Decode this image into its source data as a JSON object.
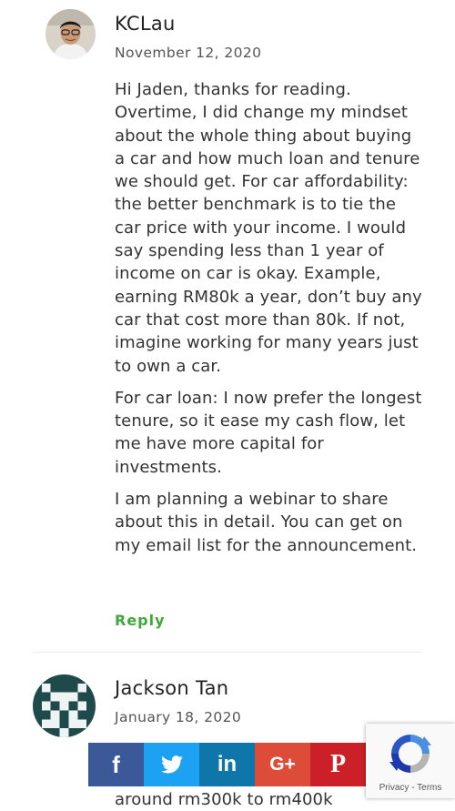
{
  "comments": [
    {
      "author": "KCLau",
      "date": "November 12, 2020",
      "paragraphs": [
        "Hi Jaden, thanks for reading. Overtime, I did change my mindset about the whole thing about buying a car and how much loan and tenure we should get. For car affordability: the better benchmark is to tie the car price with your income. I would say spending less than 1 year of income on car is okay. Example, earning RM80k a year, don’t buy any car that cost more than 80k. If not, imagine working for many years just to own a car.",
        "For car loan: I now prefer the longest tenure, so it ease my cash flow, let me have more capital for investments.",
        "I am planning a webinar to share about this in detail. You can get on my email list for the announcement."
      ],
      "reply_label": "Reply"
    },
    {
      "author": "Jackson Tan",
      "date": "January 18, 2020",
      "partial_text": "around rm300k to rm400k"
    }
  ],
  "share_bar": [
    {
      "icon": "facebook-icon",
      "label": "f",
      "color": "#3b5998"
    },
    {
      "icon": "twitter-icon",
      "label": "twitter",
      "color": "#1da1f2"
    },
    {
      "icon": "linkedin-icon",
      "label": "in",
      "color": "#0e76a8"
    },
    {
      "icon": "google-plus-icon",
      "label": "G+",
      "color": "#dd4b39"
    },
    {
      "icon": "pinterest-icon",
      "label": "P",
      "color": "#cb2027"
    }
  ],
  "recaptcha": {
    "privacy_label": "Privacy",
    "separator": " - ",
    "terms_label": "Terms"
  },
  "colors": {
    "reply_green": "#3fa83a",
    "identicon_teal": "#1f4a4c"
  }
}
